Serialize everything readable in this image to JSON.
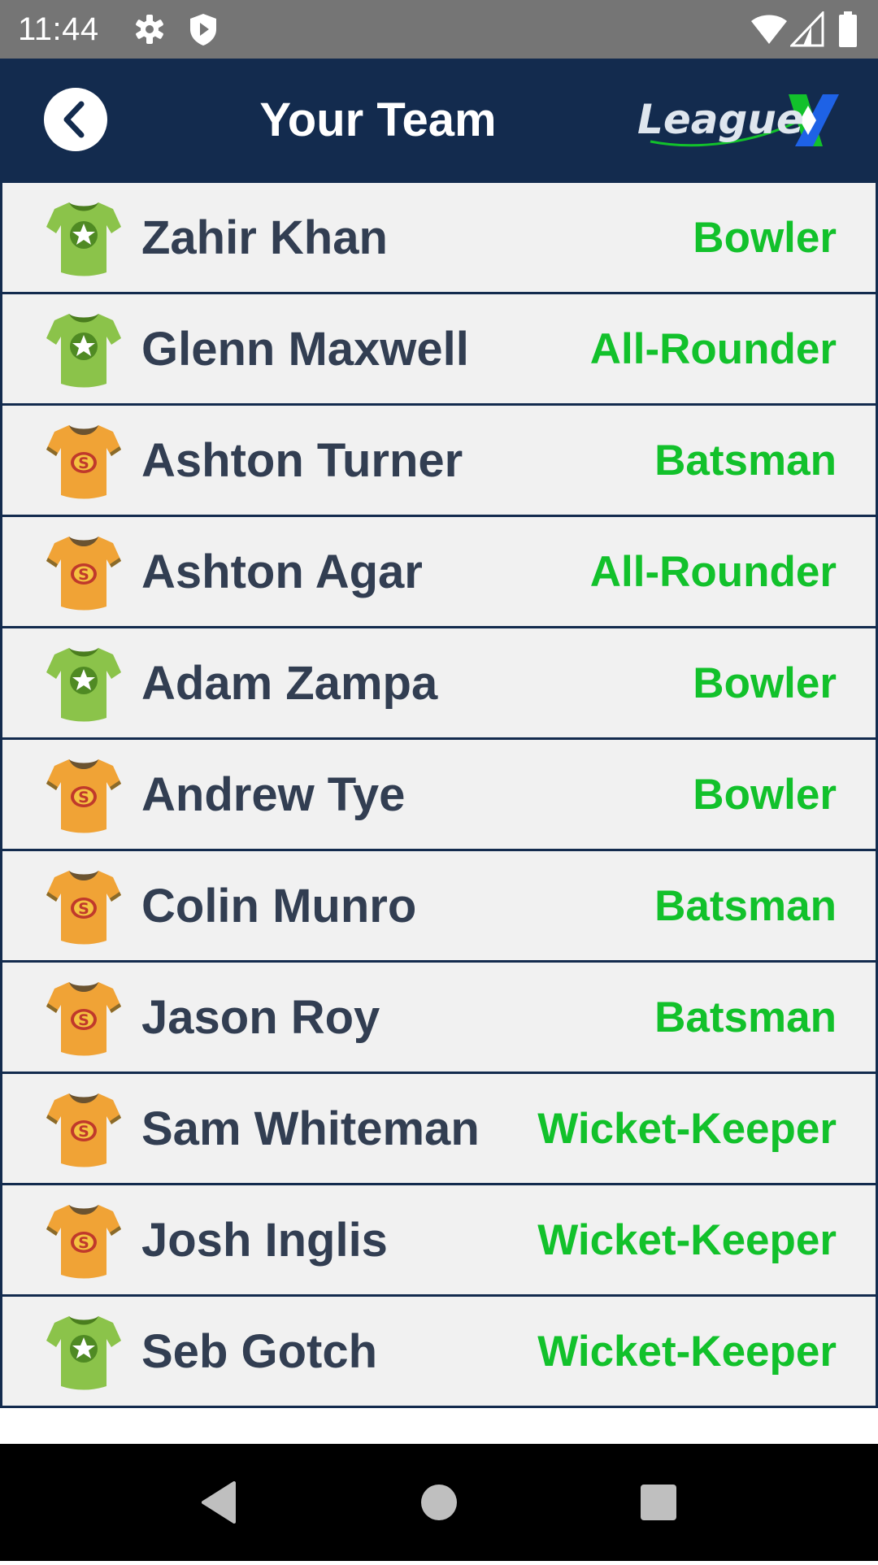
{
  "status_bar": {
    "time": "11:44",
    "icons": [
      "gear-icon",
      "shield-icon",
      "wifi-icon",
      "cell-signal-icon",
      "battery-icon"
    ]
  },
  "header": {
    "title": "Your Team",
    "back_icon": "chevron-left-icon",
    "logo_text": "League"
  },
  "colors": {
    "header_bg": "#132b4e",
    "row_bg": "#f1f1f1",
    "name_text": "#323e52",
    "role_text": "#12c12b",
    "jersey_green": "#8bc34a",
    "jersey_orange": "#f0a336"
  },
  "players": [
    {
      "name": "Zahir Khan",
      "role": "Bowler",
      "jersey": "green-star"
    },
    {
      "name": "Glenn Maxwell",
      "role": "All-Rounder",
      "jersey": "green-star"
    },
    {
      "name": "Ashton Turner",
      "role": "Batsman",
      "jersey": "orange-s"
    },
    {
      "name": "Ashton Agar",
      "role": "All-Rounder",
      "jersey": "orange-s"
    },
    {
      "name": "Adam Zampa",
      "role": "Bowler",
      "jersey": "green-star"
    },
    {
      "name": "Andrew Tye",
      "role": "Bowler",
      "jersey": "orange-s"
    },
    {
      "name": "Colin Munro",
      "role": "Batsman",
      "jersey": "orange-s"
    },
    {
      "name": "Jason Roy",
      "role": "Batsman",
      "jersey": "orange-s"
    },
    {
      "name": "Sam Whiteman",
      "role": "Wicket-Keeper",
      "jersey": "orange-s"
    },
    {
      "name": "Josh Inglis",
      "role": "Wicket-Keeper",
      "jersey": "orange-s"
    },
    {
      "name": "Seb Gotch",
      "role": "Wicket-Keeper",
      "jersey": "green-star"
    }
  ],
  "nav_bar": {
    "buttons": [
      "back-triangle-icon",
      "home-circle-icon",
      "recents-square-icon"
    ]
  }
}
